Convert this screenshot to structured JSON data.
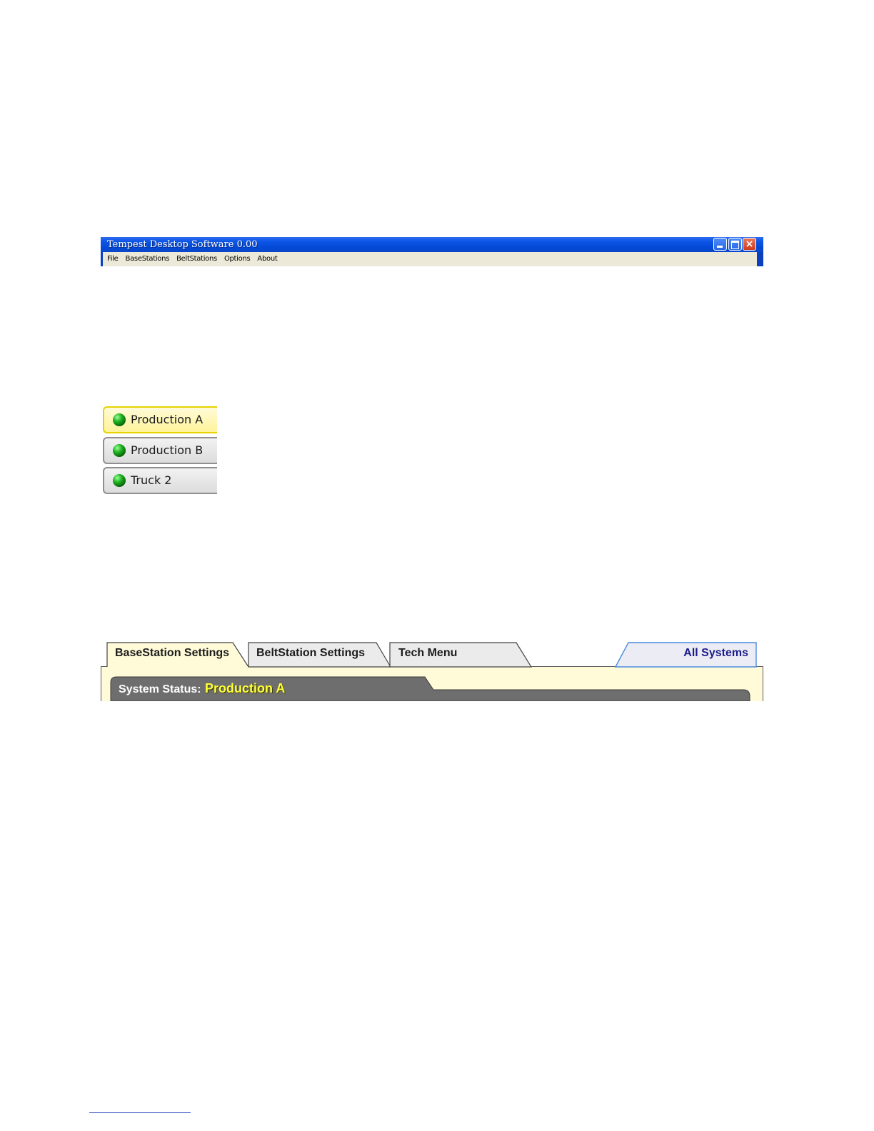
{
  "window": {
    "title": "Tempest Desktop Software 0.00",
    "controls": {
      "minimize": "minimize-icon",
      "maximize": "maximize-icon",
      "close": "×"
    },
    "menu": [
      "File",
      "BaseStations",
      "BeltStations",
      "Options",
      "About"
    ]
  },
  "stations": [
    {
      "label": "Production A",
      "status_color": "#1fb01f",
      "selected": true
    },
    {
      "label": "Production B",
      "status_color": "#1fb01f",
      "selected": false
    },
    {
      "label": "Truck 2",
      "status_color": "#1fb01f",
      "selected": false
    }
  ],
  "tabs": {
    "items": [
      "BaseStation Settings",
      "BeltStation Settings",
      "Tech Menu"
    ],
    "right": "All Systems",
    "active": "BaseStation Settings"
  },
  "status": {
    "label": "System Status:",
    "value": "Production A"
  },
  "colors": {
    "titlebar": "#0b55e6",
    "panel_bg": "#fffbd8",
    "status_bar": "#6e6e6e",
    "status_value": "#ffff3a"
  }
}
